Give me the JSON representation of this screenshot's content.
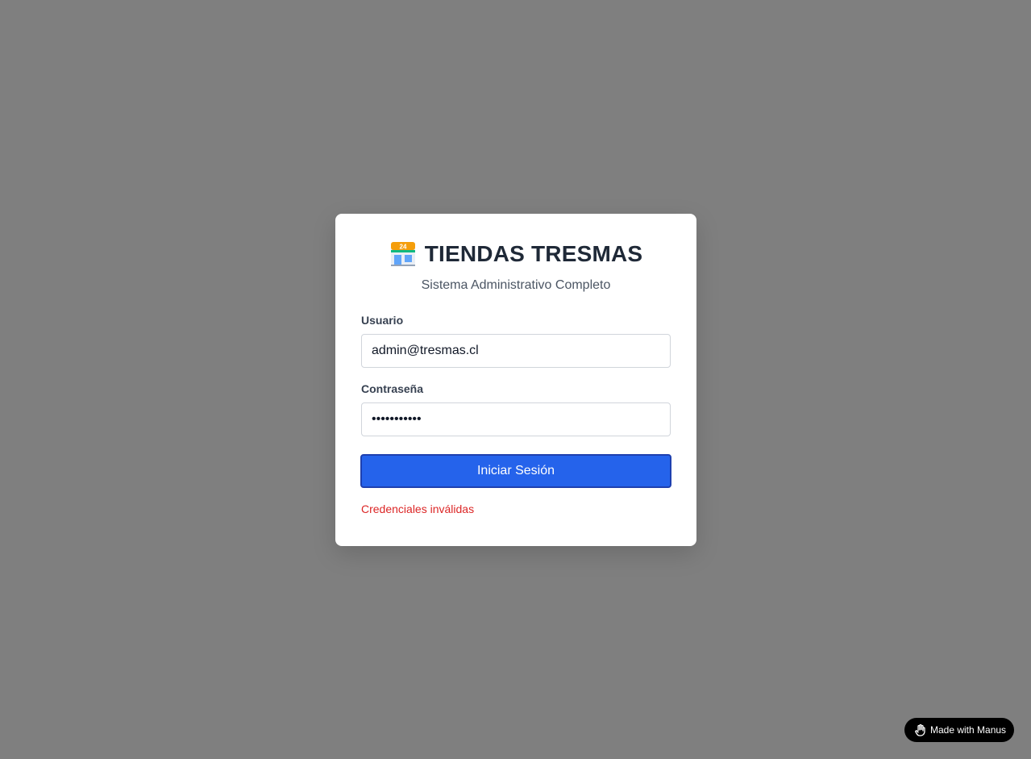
{
  "header": {
    "icon": "convenience-store-24h-icon",
    "title": "TIENDAS TRESMAS",
    "subtitle": "Sistema Administrativo Completo"
  },
  "form": {
    "username_label": "Usuario",
    "username_value": "admin@tresmas.cl",
    "password_label": "Contraseña",
    "password_value": "admin123456",
    "submit_label": "Iniciar Sesión",
    "error_message": "Credenciales inválidas"
  },
  "badge": {
    "icon": "manus-hand-icon",
    "label": "Made with Manus"
  },
  "colors": {
    "background_overlay": "#7f7f7f",
    "primary_button": "#2563eb",
    "error_text": "#dc2626",
    "title_text": "#1f2937"
  }
}
